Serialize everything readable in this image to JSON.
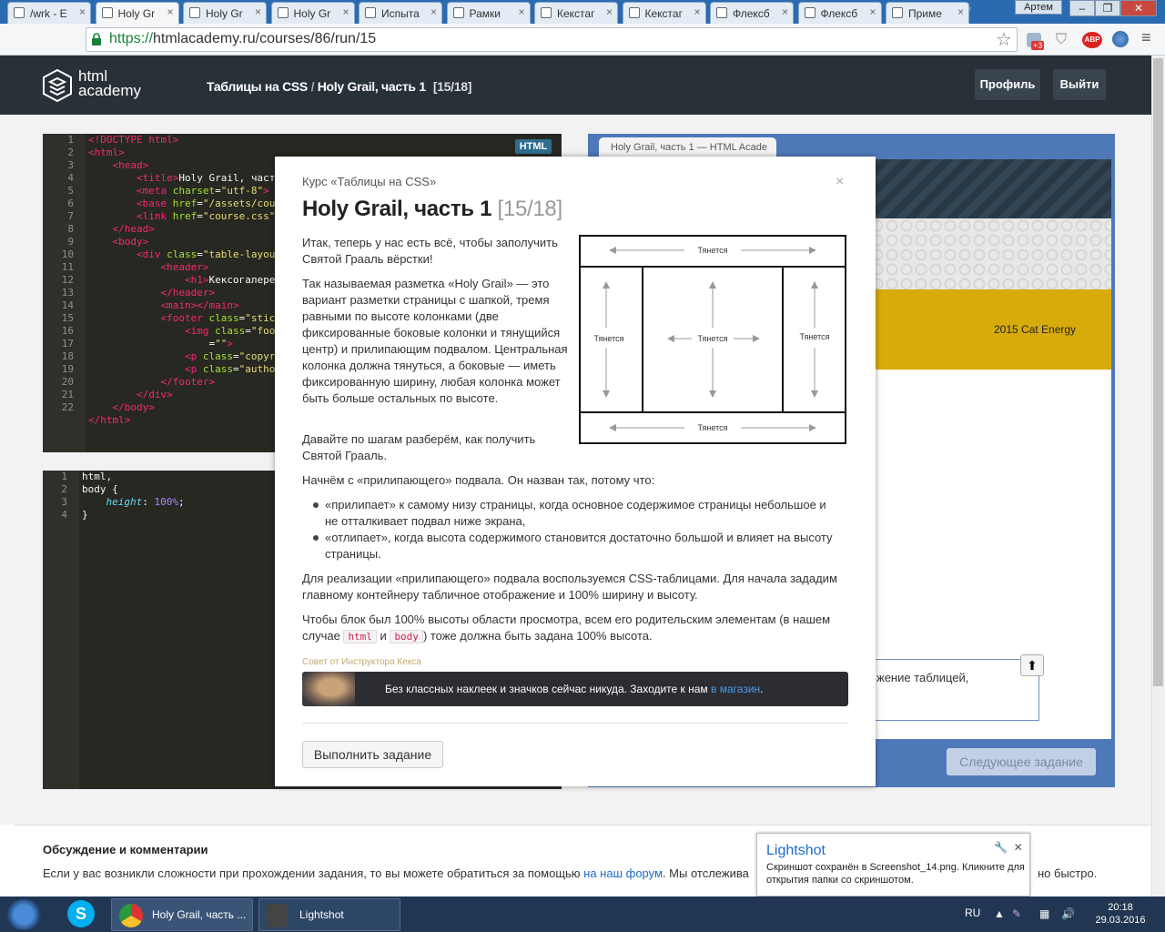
{
  "browser": {
    "tabs": [
      "/wrk - E",
      "Holy Gr",
      "Holy Gr",
      "Holy Gr",
      "Испыта",
      "Рамки",
      "Кекстаг",
      "Кекстаг",
      "Флексб",
      "Флексб",
      "Приме"
    ],
    "window_user": "Артем",
    "url_scheme": "https://",
    "url_rest": "htmlacademy.ru/courses/86/run/15",
    "badge_count": "+3",
    "abp": "ABP"
  },
  "site": {
    "logo_line1": "html",
    "logo_line2": "academy",
    "breadcrumb_course": "Таблицы на CSS",
    "breadcrumb_sep": "/",
    "breadcrumb_lesson": "Holy Grail, часть 1",
    "breadcrumb_step": "[15/18]",
    "profile_button": "Профиль",
    "logout_button": "Выйти"
  },
  "html_editor": {
    "badge": "HTML",
    "line_numbers": [
      "1",
      "2",
      "3",
      "4",
      "5",
      "6",
      "7",
      "8",
      "9",
      "10",
      "11",
      "12",
      "13",
      "14",
      "15",
      "16",
      "17",
      "18",
      "19",
      "20",
      "21",
      "22"
    ]
  },
  "css_editor": {
    "line_numbers": [
      "1",
      "2",
      "3",
      "4"
    ]
  },
  "preview": {
    "tab_title": "Holy Grail, часть 1 — HTML Acade",
    "brand_text": "2015 Cat Energy",
    "partial_text": "жение таблицей,",
    "next_button": "Следующее задание"
  },
  "modal": {
    "course_prefix": "Курс ",
    "course_link": "«Таблицы на CSS»",
    "title": "Holy Grail, часть 1",
    "step": "[15/18]",
    "close": "×",
    "p1": "Итак, теперь у нас есть всё, чтобы заполучить Святой Грааль вёрстки!",
    "p2": "Так называемая разметка «Holy Grail» — это вариант разметки страницы с шапкой, тремя равными по высоте колонками (две фиксированные боковые колонки и тянущийся центр) и прилипающим подвалом. Центральная колонка должна тянуться, а боковые — иметь фиксированную ширину, любая колонка может быть больше остальных по высоте.",
    "p3": "Давайте по шагам разберём, как получить Святой Грааль.",
    "p4": "Начнём с «прилипающего» подвала. Он назван так, потому что:",
    "b1": "«прилипает» к самому низу страницы, когда основное содержимое страницы небольшое и не отталкивает подвал ниже экрана,",
    "b2": "«отлипает», когда высота содержимого становится достаточно большой и влияет на высоту страницы.",
    "p5": "Для реализации «прилипающего» подвала воспользуемся CSS-таблицами. Для начала зададим главному контейнеру табличное отображение и 100% ширину и высоту.",
    "p6_a": "Чтобы блок был 100% высоты области просмотра, всем его родительским элементам (в нашем случае ",
    "p6_code1": "html",
    "p6_and": " и ",
    "p6_code2": "body",
    "p6_b": ") тоже должна быть задана 100% высота.",
    "diagram_label": "Тянется",
    "tip_label": "Совет от Инструктора Кекса",
    "banner_text": "Без классных наклеек и значков сейчас никуда. Заходите к нам ",
    "banner_link": "в магазин",
    "banner_end": ".",
    "action_button": "Выполнить задание"
  },
  "discussion": {
    "title": "Обсуждение и комментарии",
    "text_a": "Если у вас возникли сложности при прохождении задания, то вы можете обратиться за помощью ",
    "forum_link": "на наш форум",
    "text_b": ". Мы отслежива",
    "text_tail": "но быстро."
  },
  "lightshot": {
    "title": "Lightshot",
    "message": "Скриншот сохранён в Screenshot_14.png. Кликните для открытия папки со скриншотом."
  },
  "taskbar": {
    "chrome_item": "Holy Grail, часть ...",
    "lightshot_item": "Lightshot",
    "lang": "RU",
    "time": "20:18",
    "date": "29.03.2016"
  },
  "colors": {
    "site_header": "#283038",
    "preview_blue": "#4f78b9",
    "yellow_band": "#d7ab0b",
    "link_blue": "#1a6bc7",
    "taskbar": "#213653"
  }
}
